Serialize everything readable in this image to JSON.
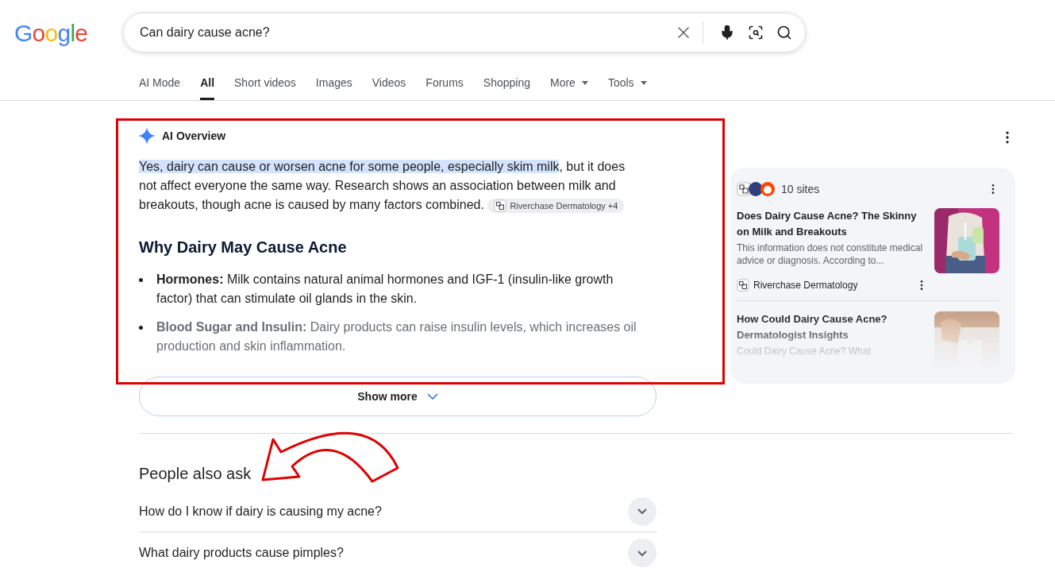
{
  "logo": {
    "letters": "Google"
  },
  "search": {
    "value": "Can dairy cause acne?"
  },
  "tabs": [
    {
      "label": "AI Mode",
      "selected": false,
      "kind": "plain"
    },
    {
      "label": "All",
      "selected": true,
      "kind": "plain"
    },
    {
      "label": "Short videos",
      "selected": false,
      "kind": "plain"
    },
    {
      "label": "Images",
      "selected": false,
      "kind": "plain"
    },
    {
      "label": "Videos",
      "selected": false,
      "kind": "plain"
    },
    {
      "label": "Forums",
      "selected": false,
      "kind": "plain"
    },
    {
      "label": "Shopping",
      "selected": false,
      "kind": "plain"
    },
    {
      "label": "More",
      "selected": false,
      "kind": "menu"
    },
    {
      "label": "Tools",
      "selected": false,
      "kind": "menu"
    }
  ],
  "ai_overview": {
    "title": "AI Overview",
    "highlight": "Yes, dairy can cause or worsen acne for some people, especially skim milk",
    "summary": ", but it does not affect everyone the same way. Research shows an association between milk and breakouts, though acne is caused by many factors combined.",
    "citation": "Riverchase Dermatology +4",
    "heading": "Why Dairy May Cause Acne",
    "bullets": [
      {
        "term": "Hormones:",
        "text": "Milk contains natural animal hormones and IGF-1 (insulin-like growth factor) that can stimulate oil glands in the skin.",
        "faded": false
      },
      {
        "term": "Blood Sugar and Insulin:",
        "text": "Dairy products can raise insulin levels, which increases oil production and skin inflammation.",
        "faded": true
      }
    ],
    "show_more": "Show more"
  },
  "sources": {
    "count": "10 sites",
    "cards": [
      {
        "title": "Does Dairy Cause Acne? The Skinny on Milk and Breakouts",
        "snippet": "This information does not constitute medical advice or diagnosis. According to...",
        "source": "Riverchase Dermatology",
        "faded": false
      },
      {
        "title": "How Could Dairy Cause Acne? Dermatologist Insights",
        "snippet": "Could Dairy Cause Acne? What",
        "faded": true
      }
    ]
  },
  "people_also_ask": {
    "title": "People also ask",
    "questions": [
      {
        "text": "How do I know if dairy is causing my acne?",
        "expanded": false
      },
      {
        "text": "What dairy products cause pimples?",
        "expanded": false
      }
    ]
  }
}
